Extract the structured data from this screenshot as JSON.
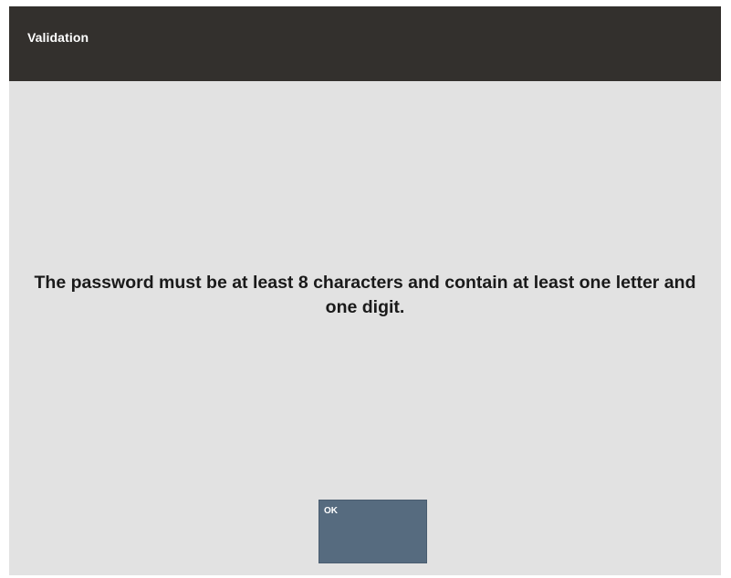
{
  "dialog": {
    "title": "Validation",
    "message": "The password must be at least 8 characters and contain at least one letter and one digit.",
    "ok_label": "OK"
  },
  "colors": {
    "titlebar": "#33302d",
    "background": "#e2e2e2",
    "button": "#566b7f"
  }
}
